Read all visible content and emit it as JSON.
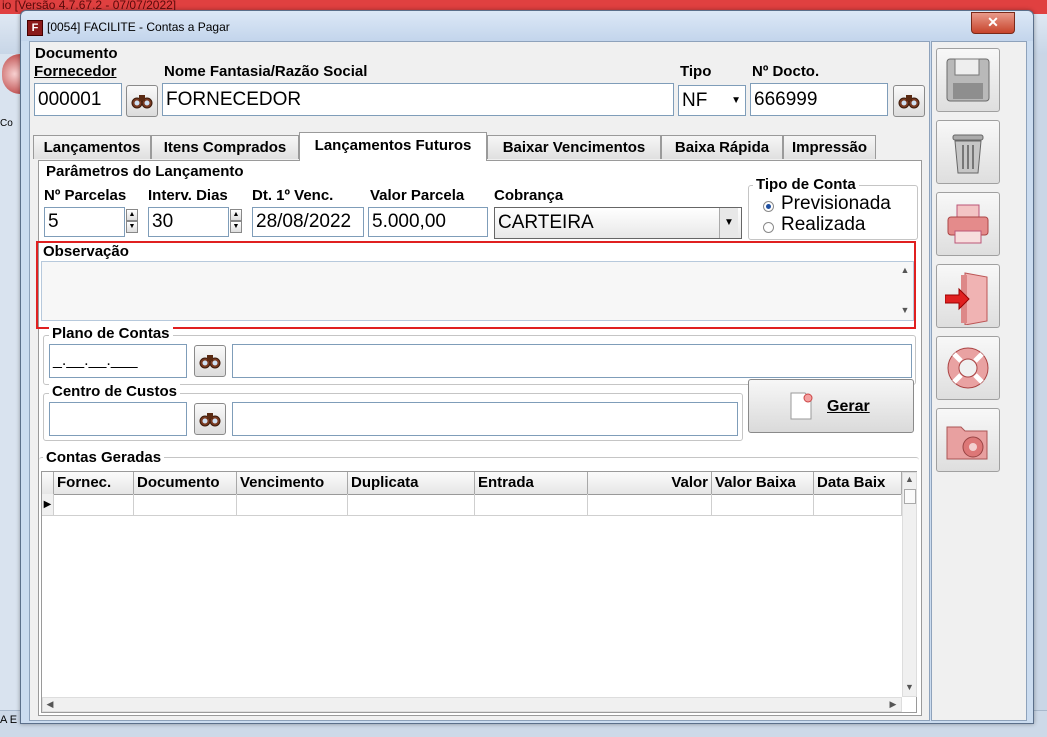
{
  "background_app": {
    "title_fragment": "io [Versão 4.7.67.2 - 07/07/2022]",
    "left_text": "Co",
    "bottom_text": "A E"
  },
  "window": {
    "title": "[0054] FACILITE - Contas a Pagar",
    "app_icon_letter": "F",
    "close_symbol": "✕"
  },
  "header": {
    "documento_label": "Documento",
    "fornecedor_label": "Fornecedor",
    "fornecedor_code": "000001",
    "nome_label": "Nome Fantasia/Razão Social",
    "nome_value": "FORNECEDOR",
    "tipo_label": "Tipo",
    "tipo_value": "NF",
    "docto_label": "Nº Docto.",
    "docto_value": "666999"
  },
  "tabs": [
    {
      "label": "Lançamentos",
      "active": false
    },
    {
      "label": "Itens Comprados",
      "active": false
    },
    {
      "label": "Lançamentos Futuros",
      "active": true
    },
    {
      "label": "Baixar Vencimentos",
      "active": false
    },
    {
      "label": "Baixa Rápida",
      "active": false
    },
    {
      "label": "Impressão",
      "active": false
    }
  ],
  "parametros": {
    "title": "Parâmetros do Lançamento",
    "parcelas_label": "Nº Parcelas",
    "parcelas_value": "5",
    "interv_label": "Interv. Dias",
    "interv_value": "30",
    "dt_label": "Dt. 1º Venc.",
    "dt_value": "28/08/2022",
    "valor_label": "Valor Parcela",
    "valor_value": "5.000,00",
    "cobranca_label": "Cobrança",
    "cobranca_value": "CARTEIRA"
  },
  "tipo_conta": {
    "title": "Tipo de Conta",
    "options": [
      {
        "label": "Previsionada",
        "selected": true
      },
      {
        "label": "Realizada",
        "selected": false
      }
    ]
  },
  "observacao": {
    "label": "Observação",
    "value": "",
    "highlight_color": "#e02020"
  },
  "plano": {
    "label": "Plano de Contas",
    "mask": "_.__.__.___",
    "description": ""
  },
  "centro": {
    "label": "Centro de Custos",
    "code": "",
    "description": ""
  },
  "gerar_button": {
    "label": "Gerar"
  },
  "contas_geradas": {
    "title": "Contas Geradas",
    "columns": [
      "Fornec.",
      "Documento",
      "Vencimento",
      "Duplicata",
      "Entrada",
      "Valor",
      "Valor Baixa",
      "Data Baix"
    ],
    "rows": [
      [
        "",
        "",
        "",
        "",
        "",
        "",
        "",
        ""
      ]
    ]
  },
  "toolbar": [
    {
      "name": "save-button",
      "icon": "floppy-disk-icon"
    },
    {
      "name": "delete-button",
      "icon": "trash-can-icon"
    },
    {
      "name": "print-button",
      "icon": "printer-icon"
    },
    {
      "name": "exit-button",
      "icon": "exit-door-icon"
    },
    {
      "name": "help-button",
      "icon": "lifebuoy-icon"
    },
    {
      "name": "settings-button",
      "icon": "folder-gear-icon"
    }
  ]
}
